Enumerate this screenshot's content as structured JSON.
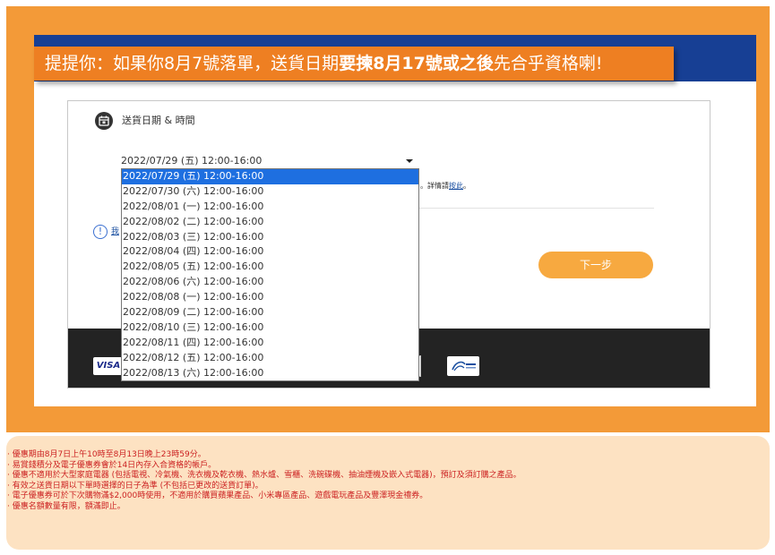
{
  "banner": {
    "prefix": "提提你：如果你8月7號落單，送貨日期",
    "bold": "要揀8月17號或之後",
    "suffix": "先合乎資格喇!"
  },
  "delivery": {
    "section_title": "送貨日期 & 時間",
    "selected_value": "2022/07/29 (五) 12:00-16:00",
    "options": [
      "2022/07/29 (五) 12:00-16:00",
      "2022/07/30 (六) 12:00-16:00",
      "2022/08/01 (一) 12:00-16:00",
      "2022/08/02 (二) 12:00-16:00",
      "2022/08/03 (三) 12:00-16:00",
      "2022/08/04 (四) 12:00-16:00",
      "2022/08/05 (五) 12:00-16:00",
      "2022/08/06 (六) 12:00-16:00",
      "2022/08/08 (一) 12:00-16:00",
      "2022/08/09 (二) 12:00-16:00",
      "2022/08/10 (三) 12:00-16:00",
      "2022/08/11 (四) 12:00-16:00",
      "2022/08/12 (五) 12:00-16:00",
      "2022/08/13 (六) 12:00-16:00"
    ],
    "note_prefix": "。詳情請",
    "note_link": "按此",
    "note_suffix": "。"
  },
  "info": {
    "link_text": "我"
  },
  "next_button": {
    "label": "下一步"
  },
  "payment": {
    "visa_label": "VISA"
  },
  "terms": [
    "· 優惠期由8月7日上午10時至8月13日晚上23時59分。",
    "· 易賞錢積分及電子優惠券會於14日內存入合資格的帳戶。",
    "· 優惠不適用於大型家庭電器 (包括電視、冷氣機、洗衣機及乾衣機、熱水爐、雪櫃、洗碗碟機、抽油煙機及嵌入式電器)，預訂及須訂購之產品。",
    "· 有效之送貨日期以下單時選擇的日子為準 (不包括已更改的送貨訂單)。",
    "· 電子優惠券可於下次購物滿$2,000時使用，不適用於購買蘋果產品、小米專區產品、遊戲電玩產品及豐澤現金禮券。",
    "· 優惠名額數量有限，額滿即止。"
  ],
  "colors": {
    "orange": "#f39a38",
    "banner_orange": "#ee7f22",
    "navy": "#173f94",
    "selected_blue": "#1e6fe0",
    "button_orange": "#f7a940",
    "terms_red": "#cc2222",
    "terms_bg": "#fde2c2"
  },
  "icons": [
    "calendar-icon",
    "info-icon",
    "chevron-down-icon",
    "octopus-logo"
  ]
}
